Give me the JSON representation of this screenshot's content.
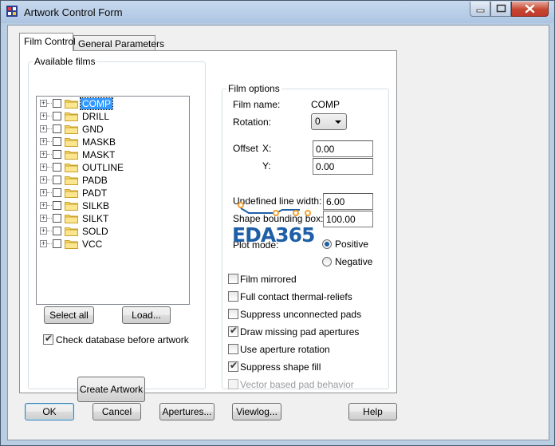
{
  "window": {
    "title": "Artwork Control Form"
  },
  "tabs": [
    {
      "label": "Film Control"
    },
    {
      "label": "General Parameters"
    }
  ],
  "available_films": {
    "legend": "Available films",
    "items": [
      {
        "name": "COMP",
        "selected": true
      },
      {
        "name": "DRILL"
      },
      {
        "name": "GND"
      },
      {
        "name": "MASKB"
      },
      {
        "name": "MASKT"
      },
      {
        "name": "OUTLINE"
      },
      {
        "name": "PADB"
      },
      {
        "name": "PADT"
      },
      {
        "name": "SILKB"
      },
      {
        "name": "SILKT"
      },
      {
        "name": "SOLD"
      },
      {
        "name": "VCC"
      }
    ],
    "select_all_label": "Select all",
    "load_label": "Load...",
    "check_db_label": "Check database before artwork",
    "check_db_checked": true,
    "create_artwork_label": "Create Artwork"
  },
  "film_options": {
    "legend": "Film options",
    "film_name_label": "Film name:",
    "film_name_value": "COMP",
    "rotation_label": "Rotation:",
    "rotation_value": "0",
    "offset_label": "Offset",
    "x_label": "X:",
    "x_value": "0.00",
    "y_label": "Y:",
    "y_value": "0.00",
    "undefined_line_width_label": "Undefined line width:",
    "undefined_line_width_value": "6.00",
    "shape_bounding_box_label": "Shape bounding box:",
    "shape_bounding_box_value": "100.00",
    "plot_mode_label": "Plot mode:",
    "plot_positive_label": "Positive",
    "plot_negative_label": "Negative",
    "plot_mode_selected": "Positive",
    "checkboxes": [
      {
        "label": "Film mirrored",
        "checked": false,
        "enabled": true
      },
      {
        "label": "Full contact thermal-reliefs",
        "checked": false,
        "enabled": true
      },
      {
        "label": "Suppress unconnected pads",
        "checked": false,
        "enabled": true
      },
      {
        "label": "Draw missing pad apertures",
        "checked": true,
        "enabled": true
      },
      {
        "label": "Use aperture rotation",
        "checked": false,
        "enabled": true
      },
      {
        "label": "Suppress shape fill",
        "checked": true,
        "enabled": true
      },
      {
        "label": "Vector based pad behavior",
        "checked": false,
        "enabled": false
      }
    ]
  },
  "watermark": {
    "text": "EDA365"
  },
  "footer": {
    "ok_label": "OK",
    "cancel_label": "Cancel",
    "apertures_label": "Apertures...",
    "viewlog_label": "Viewlog...",
    "help_label": "Help"
  },
  "colors": {
    "selection": "#3399ff",
    "watermark": "#1e5fa8",
    "watermark_accent": "#f0a030"
  }
}
